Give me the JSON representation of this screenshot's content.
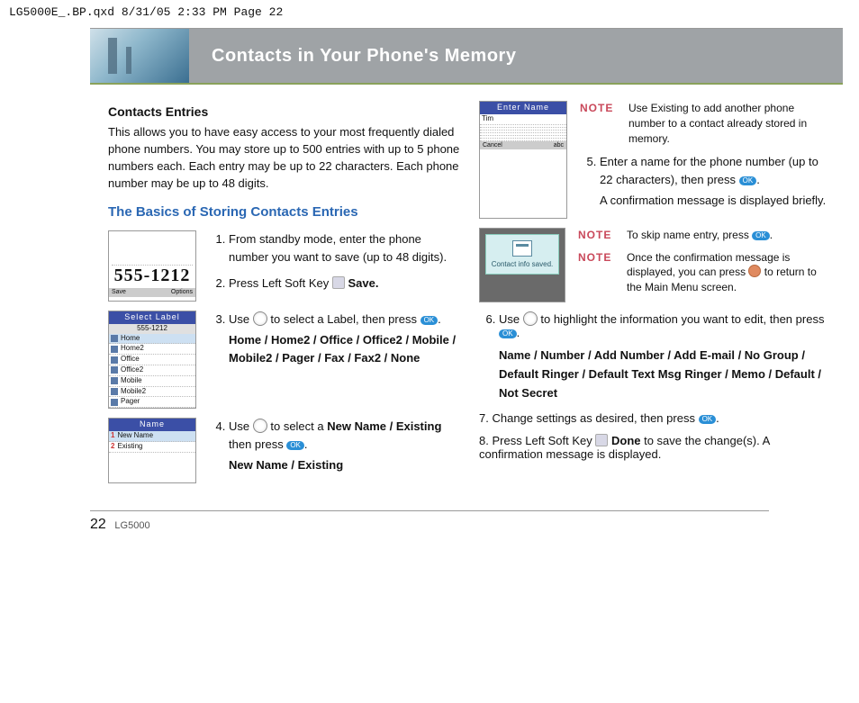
{
  "print_header": "LG5000E_.BP.qxd  8/31/05  2:33 PM  Page 22",
  "banner_title": "Contacts in Your Phone's Memory",
  "left": {
    "heading": "Contacts Entries",
    "intro": "This allows you to have easy access to your most frequently dialed phone numbers. You may store up to 500 entries with up to 5 phone numbers each. Each entry may be up to 22 characters. Each phone number may be up to 48 digits.",
    "section_heading": "The Basics of Storing Contacts Entries",
    "shot1_number": "555-1212",
    "shot1_foot_left": "Save",
    "shot1_foot_right": "Options",
    "shot2_title": "Select Label",
    "shot2_sub": "555-1212",
    "shot2_rows": [
      "Home",
      "Home2",
      "Office",
      "Office2",
      "Mobile",
      "Mobile2",
      "Pager"
    ],
    "shot3_title": "Name",
    "shot3_row1": "New Name",
    "shot3_row2": "Existing",
    "step1": "From standby mode, enter the phone number you want to save (up to 48 digits).",
    "step2a": "Press Left Soft Key ",
    "step2b": " Save.",
    "step3a": "Use ",
    "step3b": " to select a Label, then press ",
    "step3c": ".",
    "step3_labels": "Home / Home2 / Office / Office2 / Mobile / Mobile2 / Pager / Fax / Fax2 / None",
    "step4a": "Use ",
    "step4b": " to select a ",
    "step4c": "New Name / Existing",
    "step4d": " then press ",
    "step4e": ".",
    "step4_labels": "New Name / Existing"
  },
  "right": {
    "shot_enter_title": "Enter Name",
    "shot_enter_row": "Tim",
    "shot_enter_foot_left": "Cancel",
    "shot_enter_foot_right": "abc",
    "popup_text": "Contact info saved.",
    "note1": "Use Existing to add another phone number to a contact already stored in memory.",
    "step5a": "Enter a name for the phone number (up to 22 characters), then press ",
    "step5b": ".",
    "step5c": "A confirmation message is displayed briefly.",
    "note2a": "To skip name entry, press ",
    "note2b": ".",
    "note3a": "Once the confirmation message is displayed, you can press ",
    "note3b": " to return   to the Main Menu screen.",
    "step6a": "Use ",
    "step6b": " to highlight the information you want to edit, then press ",
    "step6c": ".",
    "step6_labels": "Name / Number / Add Number /  Add E-mail / No Group / Default Ringer / Default Text Msg Ringer / Memo / Default / Not Secret",
    "step7a": "Change settings as desired, then press ",
    "step7b": ".",
    "step8a": "Press Left Soft Key ",
    "step8b": " Done",
    "step8c": " to save the change(s). A confirmation message is displayed."
  },
  "note_label": "NOTE",
  "footer": {
    "page": "22",
    "model": "LG5000"
  }
}
